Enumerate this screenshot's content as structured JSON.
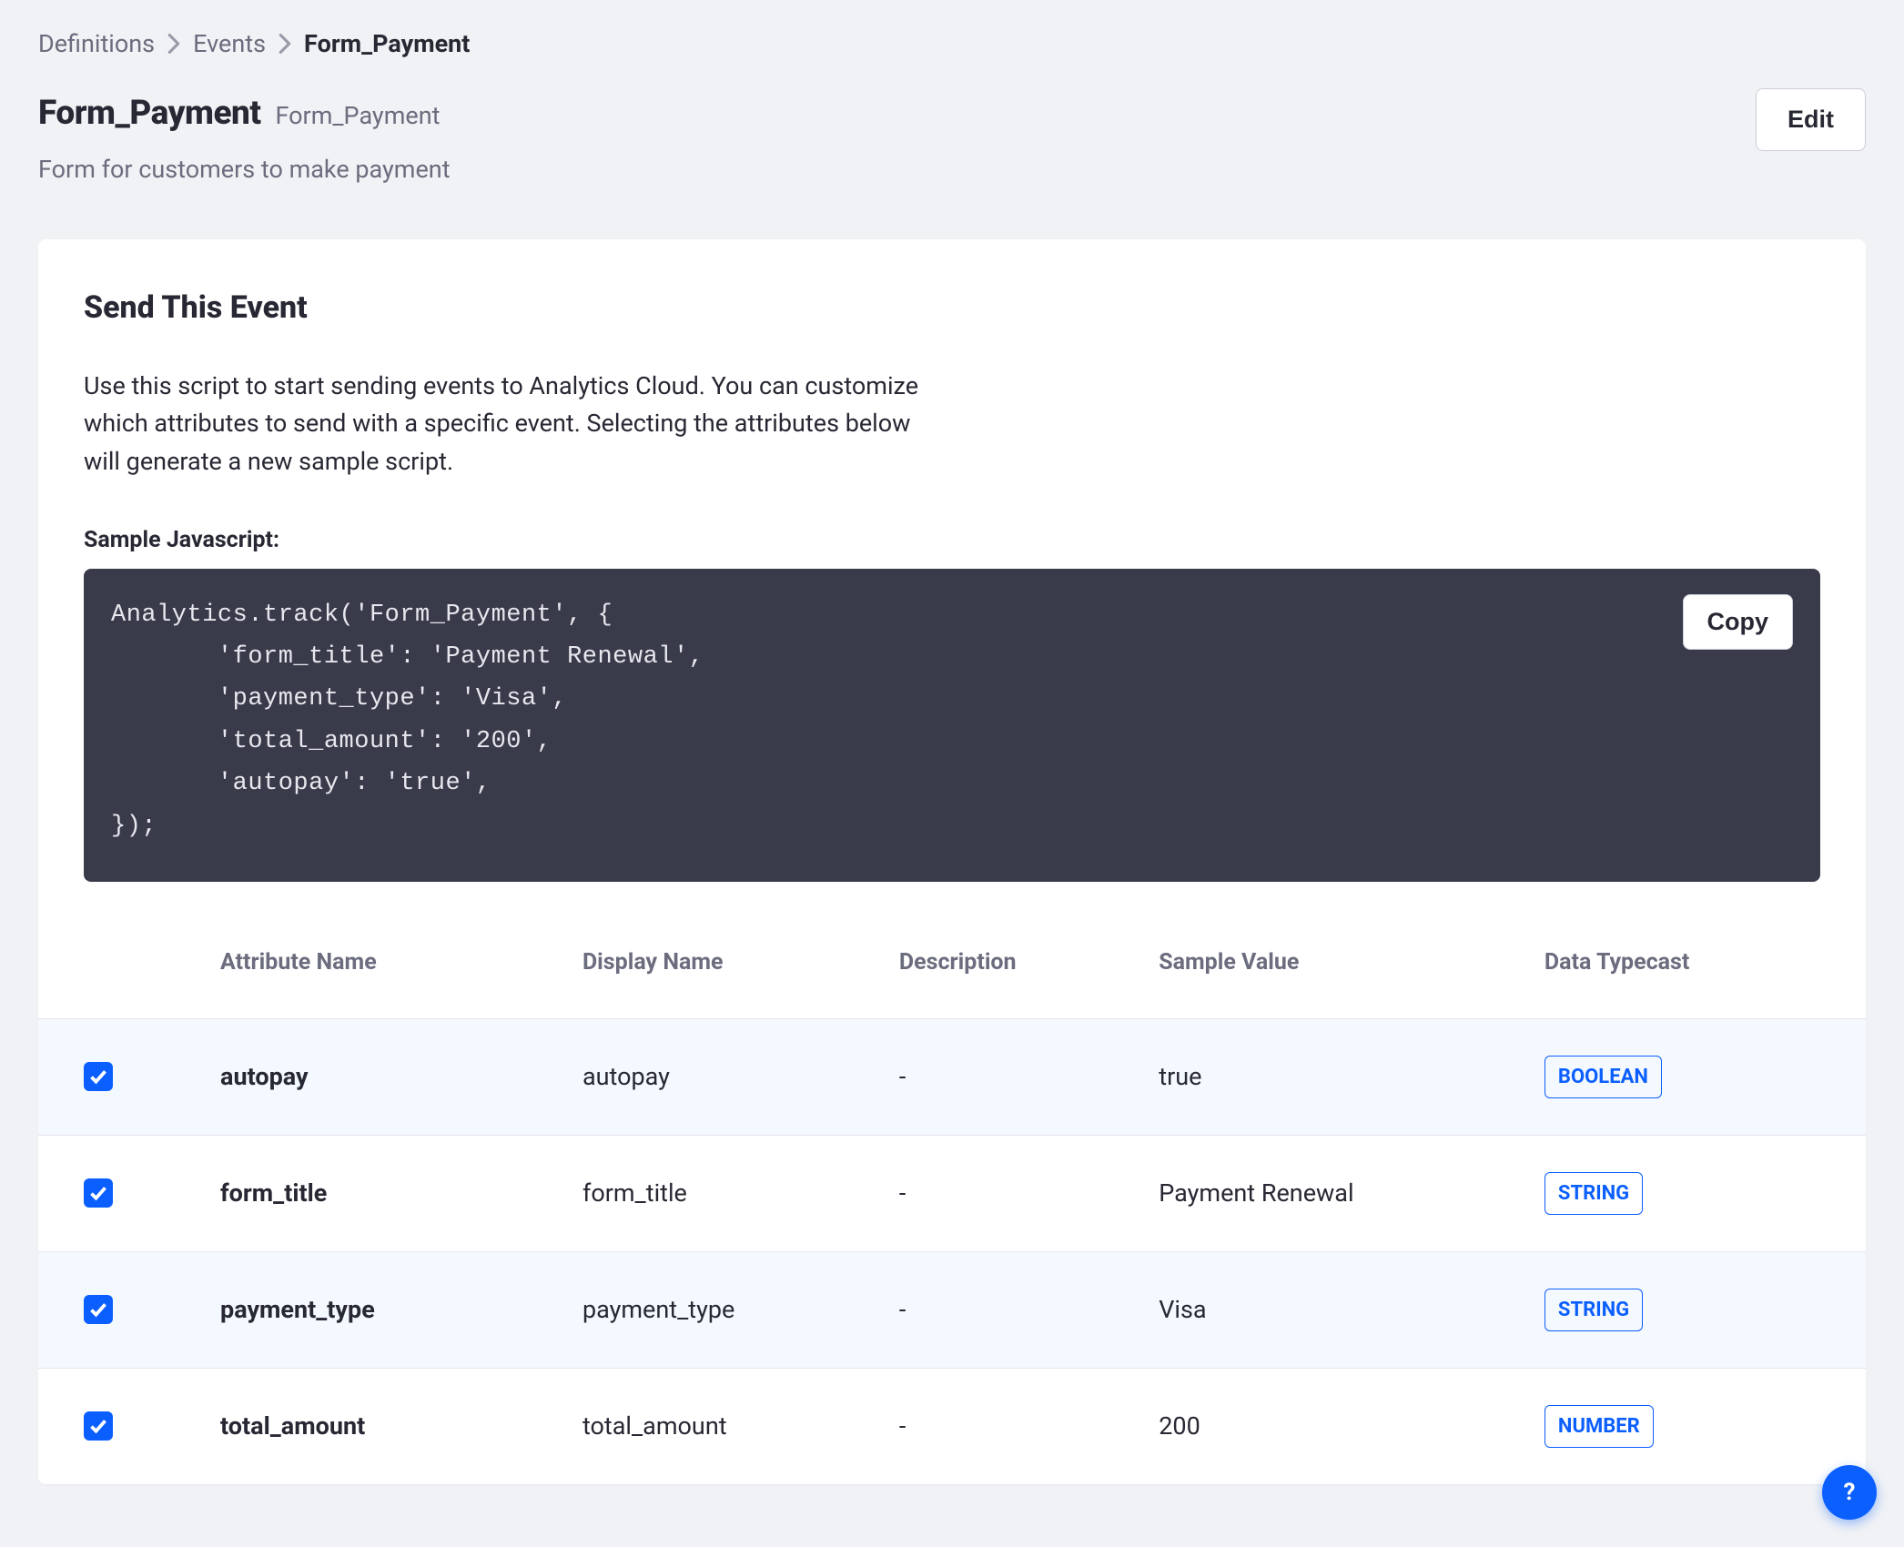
{
  "breadcrumb": {
    "items": [
      "Definitions",
      "Events"
    ],
    "current": "Form_Payment"
  },
  "header": {
    "title": "Form_Payment",
    "inline_sub": "Form_Payment",
    "desc": "Form for customers to make payment",
    "edit_label": "Edit"
  },
  "panel": {
    "title": "Send This Event",
    "desc": "Use this script to start sending events to Analytics Cloud. You can customize which attributes to send with a specific event. Selecting the attributes below will generate a new sample script.",
    "sample_label": "Sample Javascript:",
    "copy_label": "Copy",
    "code": "Analytics.track('Form_Payment', {\n       'form_title': 'Payment Renewal',\n       'payment_type': 'Visa',\n       'total_amount': '200',\n       'autopay': 'true',\n});"
  },
  "table": {
    "headers": {
      "attr": "Attribute Name",
      "display": "Display Name",
      "desc": "Description",
      "sample": "Sample Value",
      "type": "Data Typecast"
    },
    "rows": [
      {
        "checked": true,
        "attr": "autopay",
        "display": "autopay",
        "desc": "-",
        "sample": "true",
        "type": "BOOLEAN",
        "alt": true
      },
      {
        "checked": true,
        "attr": "form_title",
        "display": "form_title",
        "desc": "-",
        "sample": "Payment Renewal",
        "type": "STRING",
        "alt": false
      },
      {
        "checked": true,
        "attr": "payment_type",
        "display": "payment_type",
        "desc": "-",
        "sample": "Visa",
        "type": "STRING",
        "alt": true
      },
      {
        "checked": true,
        "attr": "total_amount",
        "display": "total_amount",
        "desc": "-",
        "sample": "200",
        "type": "NUMBER",
        "alt": false
      }
    ]
  },
  "help": {
    "label": "?"
  }
}
